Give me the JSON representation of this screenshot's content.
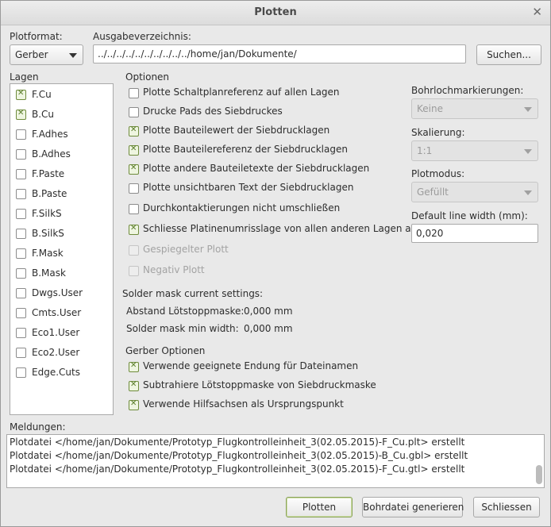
{
  "window": {
    "title": "Plotten"
  },
  "plot_format": {
    "label": "Plotformat:",
    "value": "Gerber"
  },
  "output_dir": {
    "label": "Ausgabeverzeichnis:",
    "value": "../../../../../../../../../../home/jan/Dokumente/",
    "browse_label": "Suchen..."
  },
  "layers": {
    "label": "Lagen",
    "items": [
      {
        "name": "F.Cu",
        "checked": true
      },
      {
        "name": "B.Cu",
        "checked": true
      },
      {
        "name": "F.Adhes",
        "checked": false
      },
      {
        "name": "B.Adhes",
        "checked": false
      },
      {
        "name": "F.Paste",
        "checked": false
      },
      {
        "name": "B.Paste",
        "checked": false
      },
      {
        "name": "F.SilkS",
        "checked": false
      },
      {
        "name": "B.SilkS",
        "checked": false
      },
      {
        "name": "F.Mask",
        "checked": false
      },
      {
        "name": "B.Mask",
        "checked": false
      },
      {
        "name": "Dwgs.User",
        "checked": false
      },
      {
        "name": "Cmts.User",
        "checked": false
      },
      {
        "name": "Eco1.User",
        "checked": false
      },
      {
        "name": "Eco2.User",
        "checked": false
      },
      {
        "name": "Edge.Cuts",
        "checked": false
      }
    ]
  },
  "options": {
    "label": "Optionen",
    "items": [
      {
        "label": "Plotte Schaltplanreferenz auf allen Lagen",
        "checked": false,
        "disabled": false
      },
      {
        "label": "Drucke Pads des Siebdruckes",
        "checked": false,
        "disabled": false
      },
      {
        "label": "Plotte Bauteilewert der Siebdrucklagen",
        "checked": true,
        "disabled": false
      },
      {
        "label": "Plotte Bauteilereferenz der Siebdrucklagen",
        "checked": true,
        "disabled": false
      },
      {
        "label": "Plotte andere Bauteiletexte der Siebdrucklagen",
        "checked": true,
        "disabled": false
      },
      {
        "label": "Plotte unsichtbaren Text der Siebdrucklagen",
        "checked": false,
        "disabled": false
      },
      {
        "label": "Durchkontaktierungen nicht umschließen",
        "checked": false,
        "disabled": false
      },
      {
        "label": "Schliesse Platinenumrisslage von allen anderen Lagen aus",
        "checked": true,
        "disabled": false
      },
      {
        "label": "Gespiegelter Plott",
        "checked": false,
        "disabled": true
      },
      {
        "label": "Negativ Plott",
        "checked": false,
        "disabled": true
      }
    ]
  },
  "drill_marks": {
    "label": "Bohrlochmarkierungen:",
    "value": "Keine"
  },
  "scaling": {
    "label": "Skalierung:",
    "value": "1:1"
  },
  "plot_mode": {
    "label": "Plotmodus:",
    "value": "Gefüllt"
  },
  "line_width": {
    "label": "Default line width (mm):",
    "value": "0,020"
  },
  "solder_mask": {
    "label": "Solder mask current settings:",
    "clearance_label": "Abstand Lötstoppmaske:",
    "clearance_value": "0,000 mm",
    "min_width_label": "Solder mask min width:",
    "min_width_value": "0,000 mm"
  },
  "gerber_options": {
    "label": "Gerber Optionen",
    "items": [
      {
        "label": "Verwende geeignete Endung für Dateinamen",
        "checked": true
      },
      {
        "label": "Subtrahiere Lötstoppmaske von Siebdruckmaske",
        "checked": true
      },
      {
        "label": "Verwende Hilfsachsen als Ursprungspunkt",
        "checked": true
      }
    ]
  },
  "messages": {
    "label": "Meldungen:",
    "lines": [
      "Plotdatei </home/jan/Dokumente/Prototyp_Flugkontrolleinheit_3(02.05.2015)-F_Cu.plt> erstellt",
      "Plotdatei </home/jan/Dokumente/Prototyp_Flugkontrolleinheit_3(02.05.2015)-B_Cu.gbl> erstellt",
      "Plotdatei </home/jan/Dokumente/Prototyp_Flugkontrolleinheit_3(02.05.2015)-F_Cu.gtl> erstellt"
    ]
  },
  "buttons": {
    "plot": "Plotten",
    "drill": "Bohrdatei generieren",
    "close": "Schliessen"
  },
  "icons": {
    "close": "close-icon",
    "dropdown": "chevron-down-icon",
    "check": "checkmark-icon"
  }
}
